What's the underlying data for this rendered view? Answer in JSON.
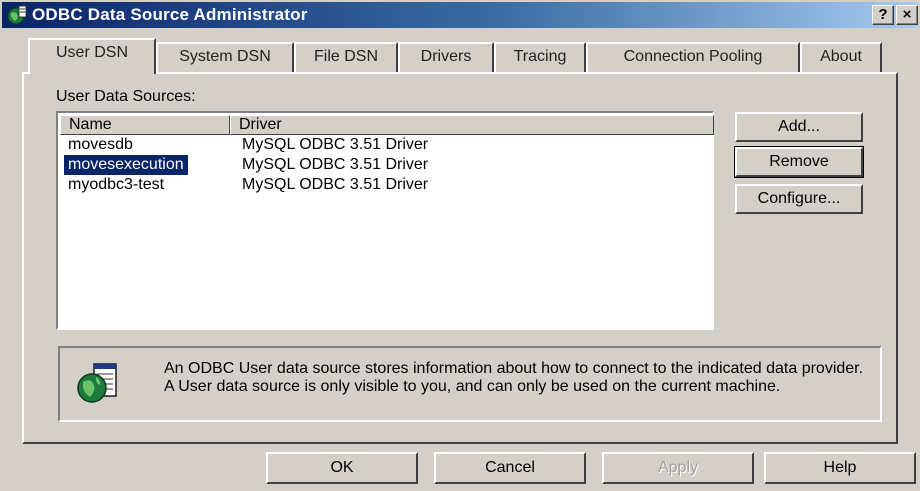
{
  "window": {
    "title": "ODBC Data Source Administrator",
    "help_button": "?",
    "close_button": "×"
  },
  "tabs": [
    {
      "label": "User DSN",
      "active": true
    },
    {
      "label": "System DSN",
      "active": false
    },
    {
      "label": "File DSN",
      "active": false
    },
    {
      "label": "Drivers",
      "active": false
    },
    {
      "label": "Tracing",
      "active": false
    },
    {
      "label": "Connection Pooling",
      "active": false
    },
    {
      "label": "About",
      "active": false
    }
  ],
  "user_dsn": {
    "group_label": "User Data Sources:",
    "columns": {
      "name": "Name",
      "driver": "Driver"
    },
    "rows": [
      {
        "name": "movesdb",
        "driver": "MySQL ODBC 3.51 Driver",
        "selected": false
      },
      {
        "name": "movesexecution",
        "driver": "MySQL ODBC 3.51 Driver",
        "selected": true
      },
      {
        "name": "myodbc3-test",
        "driver": "MySQL ODBC 3.51 Driver",
        "selected": false
      }
    ],
    "buttons": {
      "add": "Add...",
      "remove": "Remove",
      "configure": "Configure..."
    },
    "info_text": "An ODBC User data source stores information about how to connect to the indicated data provider.   A User data source is only visible to you, and can only be used on the current machine."
  },
  "footer": {
    "ok": "OK",
    "cancel": "Cancel",
    "apply": "Apply",
    "help": "Help"
  },
  "icons": {
    "title": "odbc-globe-icon",
    "info": "odbc-database-globe-icon"
  },
  "colors": {
    "titlebar": "#0a246a",
    "selection": "#0a246a",
    "face": "#d4d0c8"
  }
}
